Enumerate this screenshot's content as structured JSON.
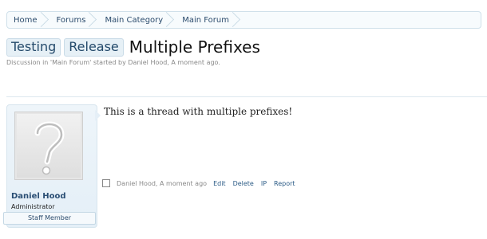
{
  "breadcrumb": [
    "Home",
    "Forums",
    "Main Category",
    "Main Forum"
  ],
  "thread": {
    "prefixes": [
      "Testing",
      "Release"
    ],
    "title": "Multiple Prefixes",
    "byline": "Discussion in 'Main Forum' started by Daniel Hood, A moment ago."
  },
  "post": {
    "username": "Daniel Hood",
    "user_title": "Administrator",
    "badge": "Staff Member",
    "message": "This is a thread with multiple prefixes!",
    "meta_author_time": "Daniel Hood, A moment ago",
    "actions": [
      "Edit",
      "Delete",
      "IP",
      "Report"
    ]
  }
}
